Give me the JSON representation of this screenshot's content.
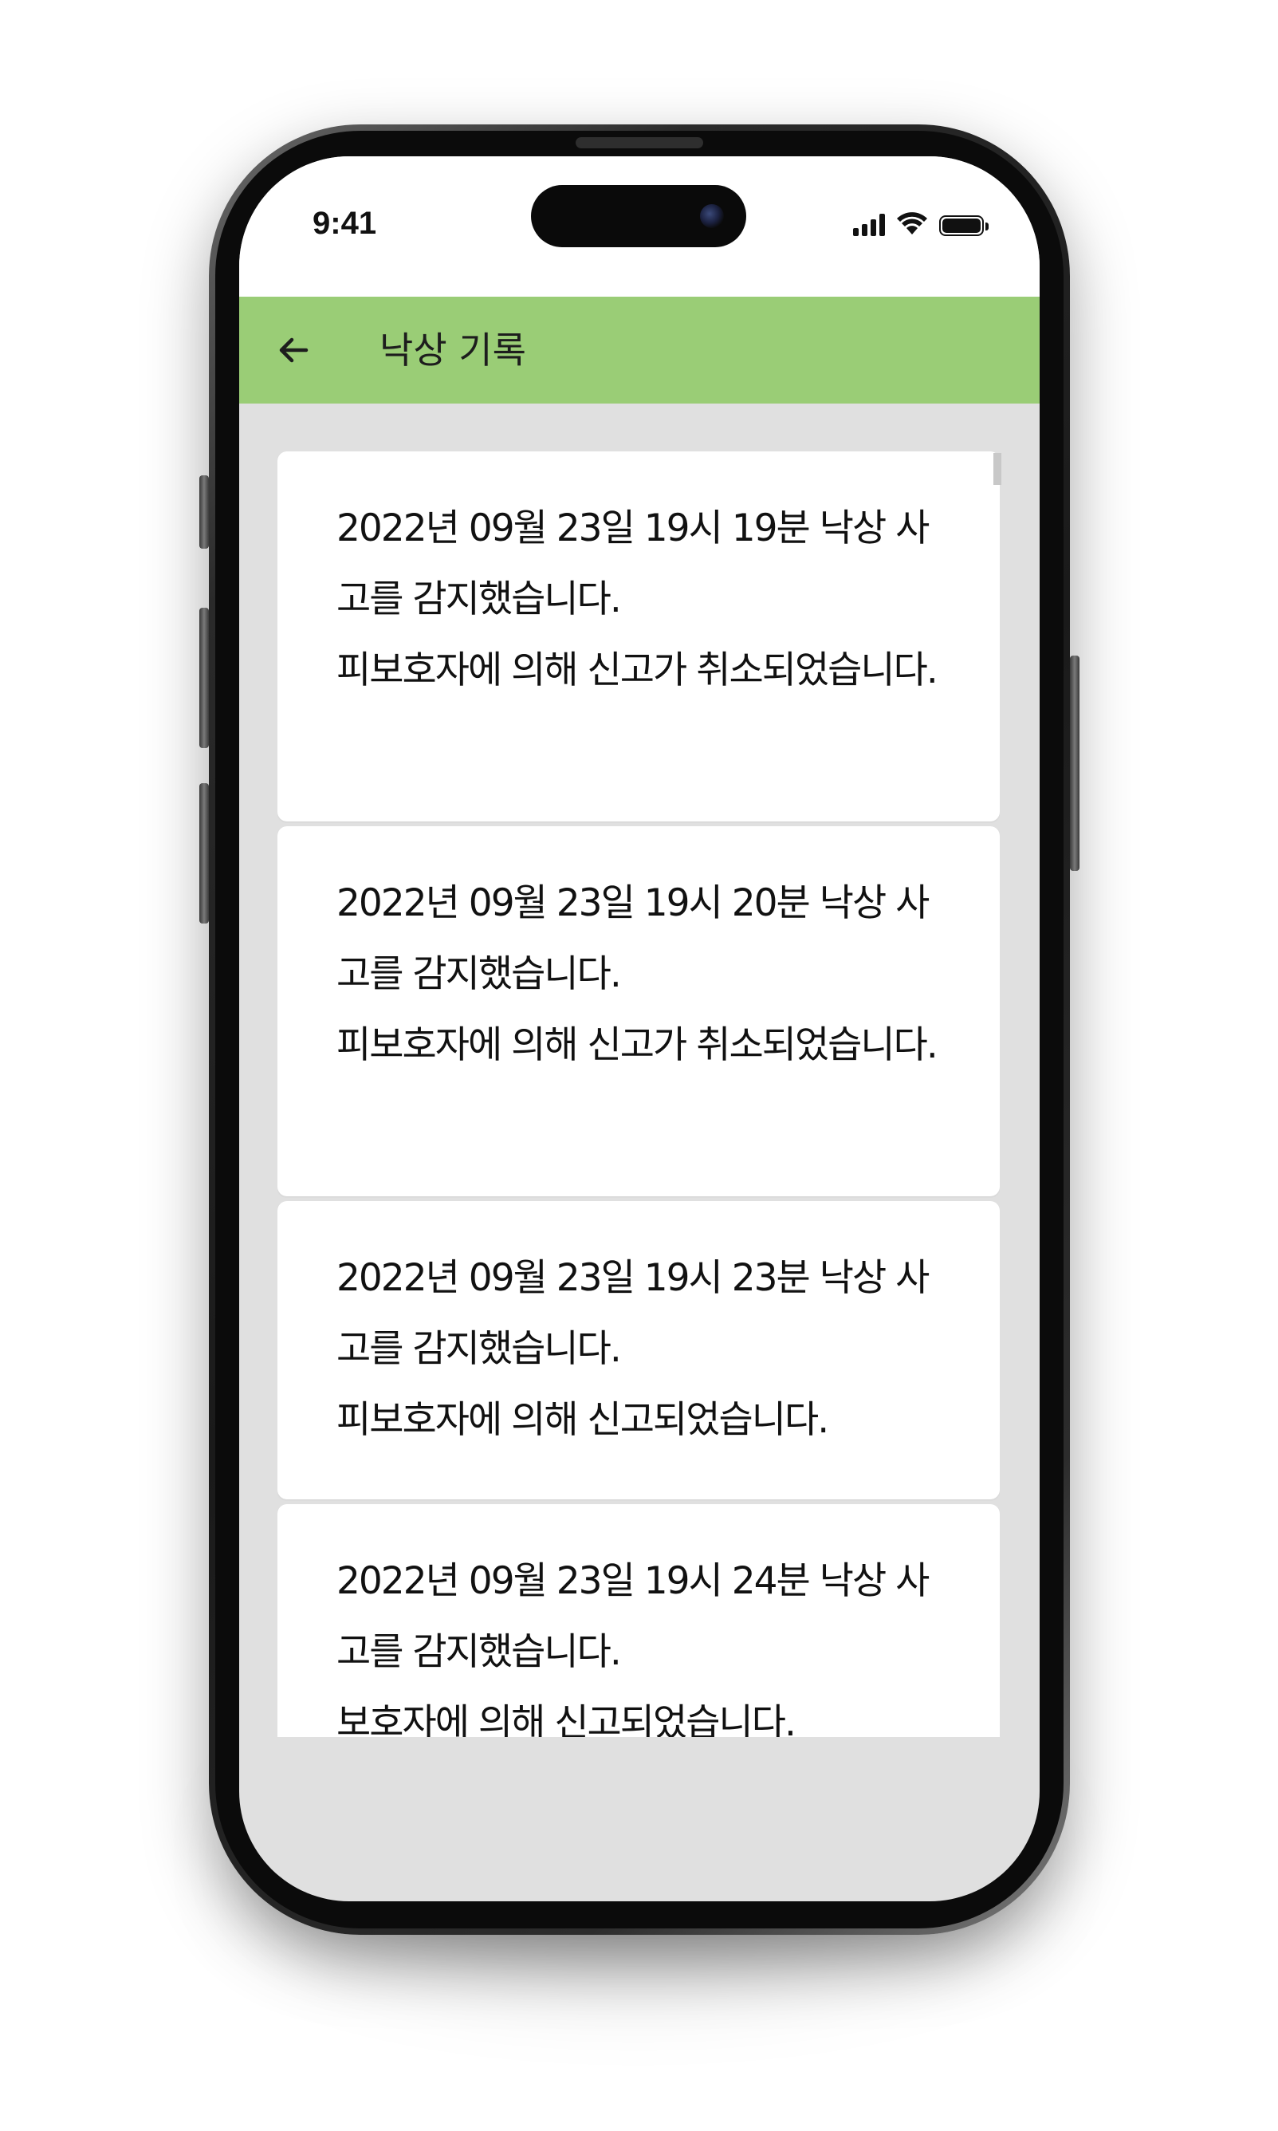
{
  "status_bar": {
    "time": "9:41",
    "icons": [
      "signal-icon",
      "wifi-icon",
      "battery-icon"
    ]
  },
  "app_bar": {
    "back_icon": "arrow-left-icon",
    "title": "낙상 기록",
    "color": "#9acd76"
  },
  "records": [
    {
      "detected": "2022년 09월 23일 19시 19분 낙상 사고를 감지했습니다.",
      "status": "피보호자에 의해 신고가 취소되었습니다."
    },
    {
      "detected": "2022년 09월 23일 19시 20분 낙상 사고를 감지했습니다.",
      "status": "피보호자에 의해 신고가 취소되었습니다."
    },
    {
      "detected": "2022년 09월 23일 19시 23분 낙상 사고를 감지했습니다.",
      "status": "피보호자에 의해 신고되었습니다."
    },
    {
      "detected": "2022년 09월 23일 19시 24분 낙상 사고를 감지했습니다.",
      "status": "보호자에 의해 신고되었습니다."
    }
  ],
  "colors": {
    "background": "#e0e0e0",
    "card": "#ffffff",
    "text": "#111111"
  }
}
